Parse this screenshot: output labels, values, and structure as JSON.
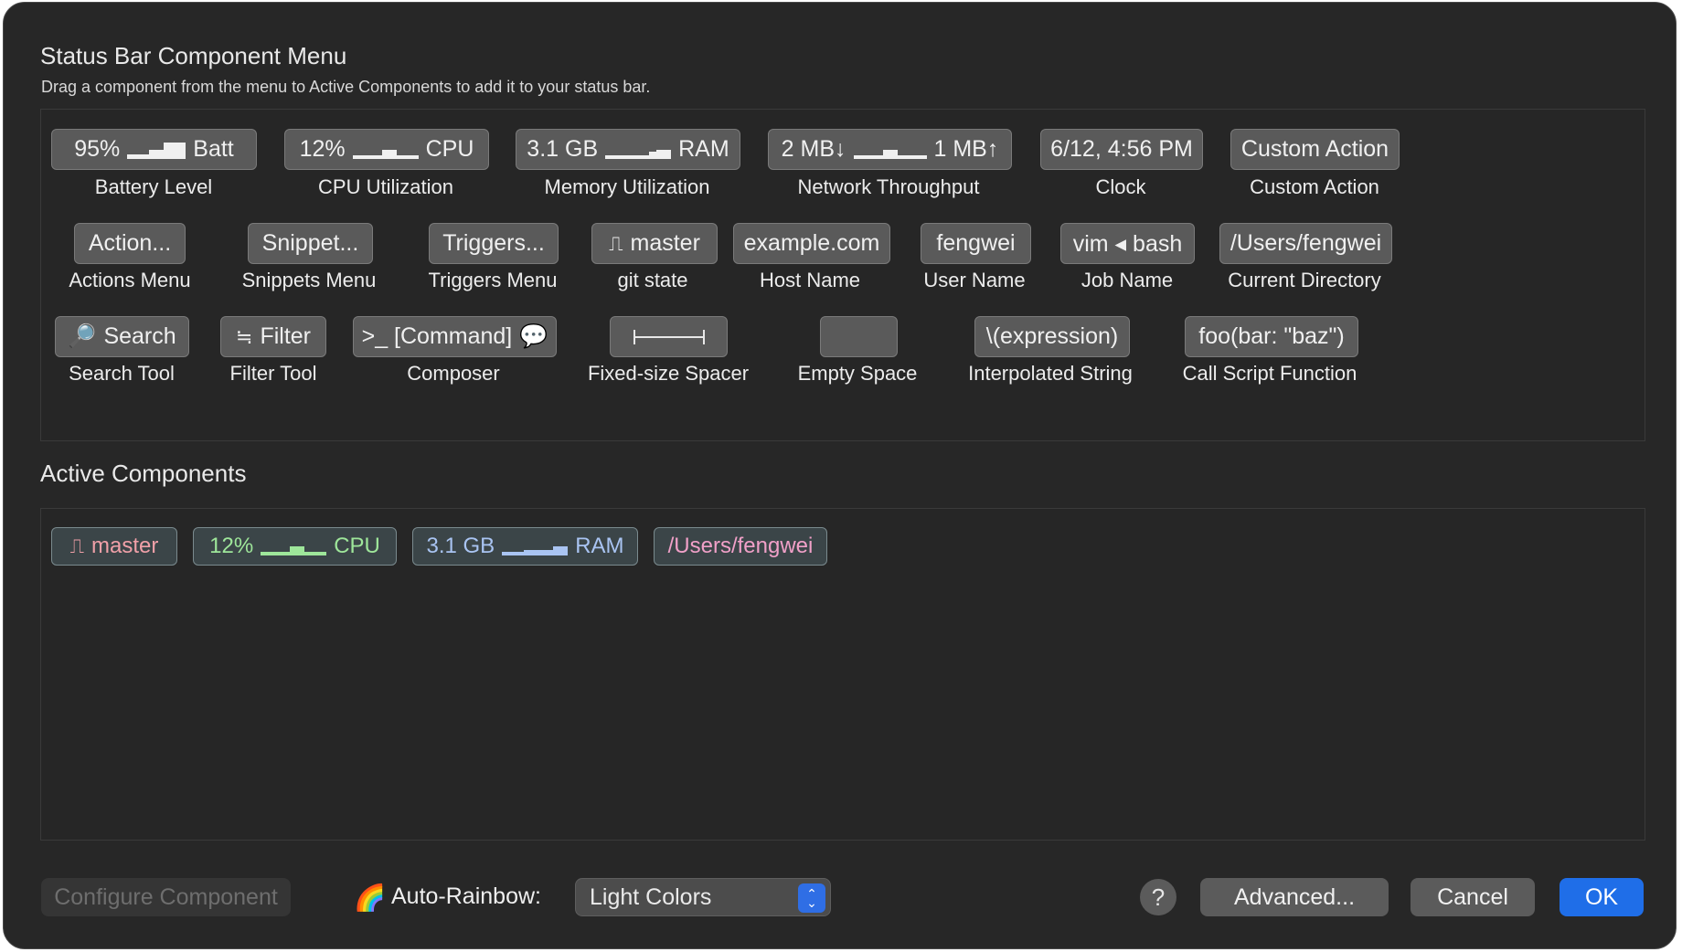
{
  "header": {
    "title": "Status Bar Component Menu",
    "subtitle": "Drag a component from the menu to Active Components to add it to your status bar."
  },
  "menu": {
    "row1": [
      {
        "chip": "95%",
        "chip_suffix": "Batt",
        "label": "Battery Level"
      },
      {
        "chip": "12%",
        "chip_suffix": "CPU",
        "label": "CPU Utilization"
      },
      {
        "chip": "3.1 GB",
        "chip_suffix": "RAM",
        "label": "Memory Utilization"
      },
      {
        "chip": "2 MB↓",
        "chip_suffix": "1 MB↑",
        "label": "Network Throughput"
      },
      {
        "chip": "6/12, 4:56 PM",
        "label": "Clock"
      },
      {
        "chip": "Custom Action",
        "label": "Custom Action"
      }
    ],
    "row2": [
      {
        "chip": "Action...",
        "label": "Actions Menu"
      },
      {
        "chip": "Snippet...",
        "label": "Snippets Menu"
      },
      {
        "chip": "Triggers...",
        "label": "Triggers Menu"
      },
      {
        "chip": "master",
        "label": "git state"
      },
      {
        "chip": "example.com",
        "label": "Host Name"
      },
      {
        "chip": "fengwei",
        "label": "User Name"
      },
      {
        "chip": "vim ◂ bash",
        "label": "Job Name"
      },
      {
        "chip": "/Users/fengwei",
        "label": "Current Directory"
      }
    ],
    "row3": [
      {
        "chip": "Search",
        "label": "Search Tool"
      },
      {
        "chip": "Filter",
        "label": "Filter Tool"
      },
      {
        "chip": ">_ [Command]",
        "label": "Composer"
      },
      {
        "chip": "",
        "label": "Fixed-size Spacer"
      },
      {
        "chip": "",
        "label": "Empty Space"
      },
      {
        "chip": "\\(expression)",
        "label": "Interpolated String"
      },
      {
        "chip": "foo(bar: \"baz\")",
        "label": "Call Script Function"
      }
    ]
  },
  "active": {
    "title": "Active Components",
    "items": [
      {
        "text": "master",
        "color": "#f0a0a8"
      },
      {
        "text": "12%",
        "suffix": "CPU",
        "color": "#9ee69a"
      },
      {
        "text": "3.1 GB",
        "suffix": "RAM",
        "color": "#a9c4f2"
      },
      {
        "text": "/Users/fengwei",
        "color": "#f0a0c8"
      }
    ]
  },
  "footer": {
    "configure": "Configure Component",
    "rainbow_label": "Auto-Rainbow:",
    "rainbow_value": "Light Colors",
    "help": "?",
    "advanced": "Advanced...",
    "cancel": "Cancel",
    "ok": "OK"
  }
}
